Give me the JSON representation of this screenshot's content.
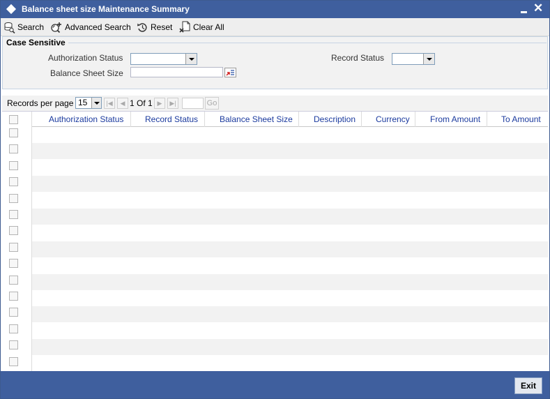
{
  "window": {
    "title": "Balance sheet size Maintenance Summary"
  },
  "toolbar": {
    "search": "Search",
    "advanced_search": "Advanced Search",
    "reset": "Reset",
    "clear_all": "Clear All"
  },
  "criteria": {
    "section_label": "Case Sensitive",
    "authorization_status_label": "Authorization Status",
    "authorization_status_value": "",
    "record_status_label": "Record Status",
    "record_status_value": "",
    "balance_sheet_size_label": "Balance Sheet Size",
    "balance_sheet_size_value": ""
  },
  "pager": {
    "records_per_page_label": "Records per page",
    "records_per_page_value": "15",
    "page_info": "1 Of 1",
    "go_label": "Go"
  },
  "grid": {
    "columns": [
      "Authorization Status",
      "Record Status",
      "Balance Sheet Size",
      "Description",
      "Currency",
      "From Amount",
      "To Amount"
    ],
    "row_count": 15
  },
  "footer": {
    "exit_label": "Exit"
  },
  "colors": {
    "title_bar": "#3f5f9e",
    "header_text": "#1b3a9e",
    "row_alt": "#f2f2f2"
  }
}
